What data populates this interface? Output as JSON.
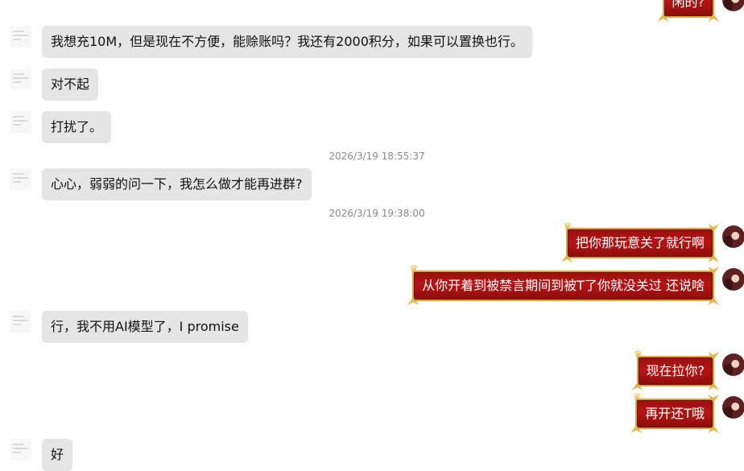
{
  "chat": {
    "messages": [
      {
        "side": "right",
        "text": "闲的?"
      },
      {
        "side": "left",
        "text": "我想充10M，但是现在不方便，能赊账吗？我还有2000积分，如果可以置换也行。"
      },
      {
        "side": "left",
        "text": "对不起"
      },
      {
        "side": "left",
        "text": "打扰了。"
      },
      {
        "side": "time",
        "text": "2026/3/19 18:55:37"
      },
      {
        "side": "left",
        "text": "心心，弱弱的问一下，我怎么做才能再进群?"
      },
      {
        "side": "time",
        "text": "2026/3/19 19:38:00"
      },
      {
        "side": "right",
        "text": "把你那玩意关了就行啊"
      },
      {
        "side": "right",
        "text": "从你开着到被禁言期间到被T了你就没关过  还说啥"
      },
      {
        "side": "left",
        "text": "行，我不用AI模型了，I promise"
      },
      {
        "side": "right",
        "text": "现在拉你?"
      },
      {
        "side": "right",
        "text": "再开还T哦"
      },
      {
        "side": "left",
        "text": "好"
      }
    ]
  },
  "colors": {
    "incoming_bubble": "#e5e5e5",
    "outgoing_bubble": "#b71414",
    "outgoing_border": "#d9a33b",
    "timestamp": "#8a8a8a"
  },
  "icons": {
    "incoming_avatar": "avatar-icon",
    "outgoing_avatar": "avatar-icon",
    "crown": "crown-icon"
  }
}
